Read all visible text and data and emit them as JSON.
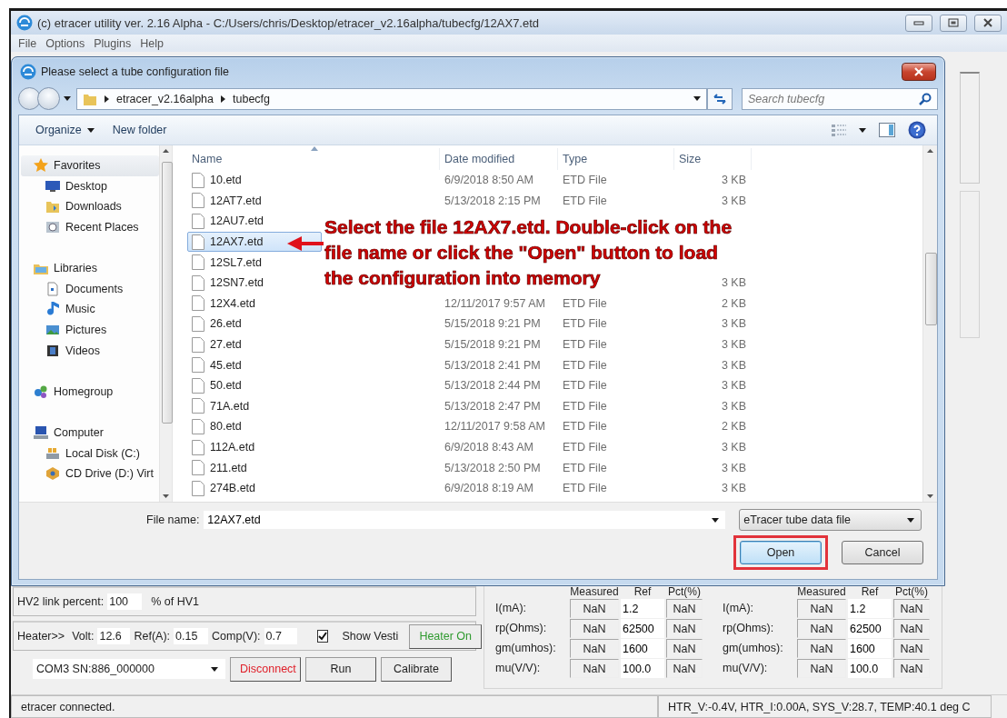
{
  "window": {
    "title": "(c) etracer utility ver. 2.16 Alpha - C:/Users/chris/Desktop/etracer_v2.16alpha/tubecfg/12AX7.etd"
  },
  "menu": [
    "File",
    "Options",
    "Plugins",
    "Help"
  ],
  "dialog": {
    "title": "Please select a tube configuration file",
    "breadcrumb": [
      "etracer_v2.16alpha",
      "tubecfg"
    ],
    "search": {
      "placeholder": "Search tubecfg"
    },
    "toolbar": [
      {
        "label": "Organize",
        "menu": true
      },
      {
        "label": "New folder",
        "menu": false
      }
    ],
    "nav": [
      {
        "label": "Favorites",
        "selected": true,
        "children": [
          {
            "label": "Desktop",
            "selected": false
          },
          {
            "label": "Downloads",
            "selected": false
          },
          {
            "label": "Recent Places",
            "selected": false
          }
        ]
      },
      {
        "label": "Libraries",
        "selected": false,
        "children": [
          {
            "label": "Documents",
            "selected": false
          },
          {
            "label": "Music",
            "selected": false
          },
          {
            "label": "Pictures",
            "selected": false
          },
          {
            "label": "Videos",
            "selected": false
          }
        ]
      },
      {
        "label": "Homegroup",
        "selected": false
      },
      {
        "label": "Computer",
        "selected": false,
        "children": [
          {
            "label": "Local Disk (C:)",
            "selected": false
          },
          {
            "label": "CD Drive (D:) Virt",
            "selected": false
          }
        ]
      }
    ],
    "columns": [
      "Name",
      "Date modified",
      "Type",
      "Size"
    ],
    "files": [
      {
        "name": "10.etd",
        "date": "6/9/2018 8:50 AM",
        "type": "ETD File",
        "size": "3 KB",
        "selected": false
      },
      {
        "name": "12AT7.etd",
        "date": "5/13/2018 2:15 PM",
        "type": "ETD File",
        "size": "3 KB",
        "selected": false
      },
      {
        "name": "12AU7.etd",
        "selected": false
      },
      {
        "name": "12AX7.etd",
        "selected": true
      },
      {
        "name": "12SL7.etd",
        "selected": false
      },
      {
        "name": "12SN7.etd",
        "size": "3 KB",
        "selected": false
      },
      {
        "name": "12X4.etd",
        "date": "12/11/2017 9:57 AM",
        "type": "ETD File",
        "size": "2 KB",
        "selected": false
      },
      {
        "name": "26.etd",
        "date": "5/15/2018 9:21 PM",
        "type": "ETD File",
        "size": "3 KB",
        "selected": false
      },
      {
        "name": "27.etd",
        "date": "5/15/2018 9:21 PM",
        "type": "ETD File",
        "size": "3 KB",
        "selected": false
      },
      {
        "name": "45.etd",
        "date": "5/13/2018 2:41 PM",
        "type": "ETD File",
        "size": "3 KB",
        "selected": false
      },
      {
        "name": "50.etd",
        "date": "5/13/2018 2:44 PM",
        "type": "ETD File",
        "size": "3 KB",
        "selected": false
      },
      {
        "name": "71A.etd",
        "date": "5/13/2018 2:47 PM",
        "type": "ETD File",
        "size": "3 KB",
        "selected": false
      },
      {
        "name": "80.etd",
        "date": "12/11/2017 9:58 AM",
        "type": "ETD File",
        "size": "2 KB",
        "selected": false
      },
      {
        "name": "112A.etd",
        "date": "6/9/2018 8:43 AM",
        "type": "ETD File",
        "size": "3 KB",
        "selected": false
      },
      {
        "name": "211.etd",
        "date": "5/13/2018 2:50 PM",
        "type": "ETD File",
        "size": "3 KB",
        "selected": false
      },
      {
        "name": "274B.etd",
        "date": "6/9/2018 8:19 AM",
        "type": "ETD File",
        "size": "3 KB",
        "selected": false
      }
    ],
    "file_name": {
      "label": "File name:",
      "value": "12AX7.etd"
    },
    "filter": "eTracer tube data file",
    "buttons": [
      {
        "label": "Open",
        "default": true,
        "highlighted": true
      },
      {
        "label": "Cancel",
        "default": false,
        "highlighted": false
      }
    ]
  },
  "annotation": {
    "lines": [
      "Select the file 12AX7.etd. Double-click on the",
      "file name or click the \"Open\" button to load",
      "the configuration into memory"
    ]
  },
  "hv2": {
    "label": "HV2 link percent:",
    "value": "100",
    "unit": "% of HV1"
  },
  "heater": {
    "label": "Heater>>",
    "fields": [
      {
        "label": "Volt:",
        "value": "12.6"
      },
      {
        "label": "Ref(A):",
        "value": "0.15"
      },
      {
        "label": "Comp(V):",
        "value": "0.7"
      }
    ],
    "checkbox": {
      "label": "Show Vesti",
      "checked": true
    },
    "button": {
      "label": "Heater On",
      "color": "#2f9a2f"
    }
  },
  "connection": {
    "port": "COM3 SN:886_000000",
    "buttons": [
      {
        "label": "Disconnect",
        "color": "#e0202a"
      },
      {
        "label": "Run",
        "color": "#1e1e1e"
      },
      {
        "label": "Calibrate",
        "color": "#1e1e1e"
      }
    ]
  },
  "tables": [
    {
      "columns": [
        "Measured",
        "Ref",
        "Pct(%)"
      ],
      "rows": [
        {
          "label": "I(mA):",
          "measured": "NaN",
          "ref": "1.2",
          "pct": "NaN"
        },
        {
          "label": "rp(Ohms):",
          "measured": "NaN",
          "ref": "62500",
          "pct": "NaN"
        },
        {
          "label": "gm(umhos):",
          "measured": "NaN",
          "ref": "1600",
          "pct": "NaN"
        },
        {
          "label": "mu(V/V):",
          "measured": "NaN",
          "ref": "100.0",
          "pct": "NaN"
        }
      ]
    },
    {
      "columns": [
        "Measured",
        "Ref",
        "Pct(%)"
      ],
      "rows": [
        {
          "label": "I(mA):",
          "measured": "NaN",
          "ref": "1.2",
          "pct": "NaN"
        },
        {
          "label": "rp(Ohms):",
          "measured": "NaN",
          "ref": "62500",
          "pct": "NaN"
        },
        {
          "label": "gm(umhos):",
          "measured": "NaN",
          "ref": "1600",
          "pct": "NaN"
        },
        {
          "label": "mu(V/V):",
          "measured": "NaN",
          "ref": "100.0",
          "pct": "NaN"
        }
      ]
    }
  ],
  "status_bar": {
    "message": "etracer connected.",
    "readings": "HTR_V:-0.4V, HTR_I:0.00A, SYS_V:28.7, TEMP:40.1 deg C"
  }
}
